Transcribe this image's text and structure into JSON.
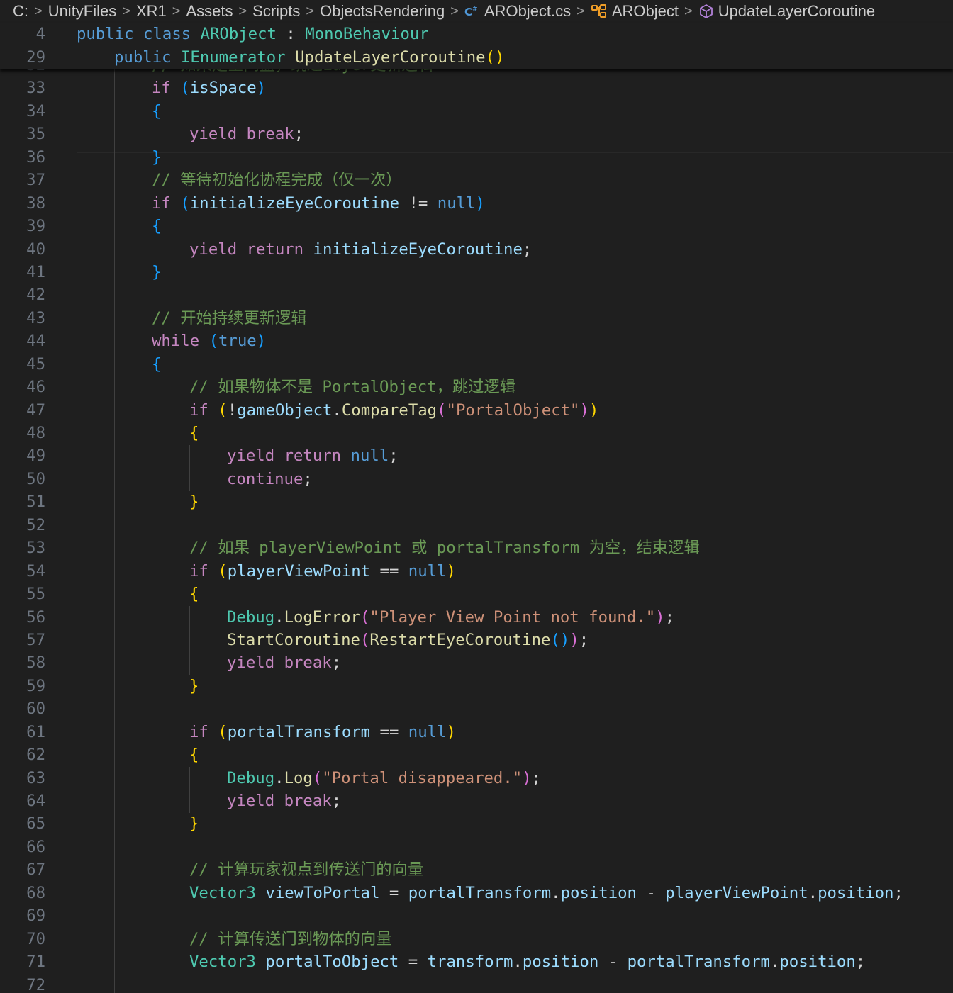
{
  "breadcrumb": {
    "items": [
      {
        "label": "C:",
        "icon": null
      },
      {
        "label": "UnityFiles",
        "icon": null
      },
      {
        "label": "XR1",
        "icon": null
      },
      {
        "label": "Assets",
        "icon": null
      },
      {
        "label": "Scripts",
        "icon": null
      },
      {
        "label": "ObjectsRendering",
        "icon": null
      },
      {
        "label": "ARObject.cs",
        "icon": "csharp-file-icon"
      },
      {
        "label": "ARObject",
        "icon": "class-icon"
      },
      {
        "label": "UpdateLayerCoroutine",
        "icon": "method-icon"
      }
    ],
    "separator": ">"
  },
  "sticky": [
    {
      "num": "4",
      "tokens": [
        [
          "public",
          "kw"
        ],
        [
          " "
        ],
        [
          "class",
          "kw"
        ],
        [
          " "
        ],
        [
          "ARObject",
          "typ"
        ],
        [
          " : "
        ],
        [
          "MonoBehaviour",
          "typ"
        ]
      ]
    },
    {
      "num": "29",
      "indent": 1,
      "tokens": [
        [
          "public",
          "kw"
        ],
        [
          " "
        ],
        [
          "IEnumerator",
          "typ"
        ],
        [
          " "
        ],
        [
          "UpdateLayerCoroutine",
          "fn"
        ],
        [
          "(",
          "p1"
        ],
        [
          ")",
          "p1"
        ]
      ]
    }
  ],
  "code": [
    {
      "num": "32",
      "indent": 2,
      "tokens": [
        [
          "// 如果是空间盒，跳过Layer更新逻辑",
          "cmt"
        ]
      ]
    },
    {
      "num": "33",
      "indent": 2,
      "tokens": [
        [
          "if",
          "ctl"
        ],
        [
          " "
        ],
        [
          "(",
          "p3"
        ],
        [
          "isSpace",
          "var"
        ],
        [
          ")",
          "p3"
        ]
      ]
    },
    {
      "num": "34",
      "indent": 2,
      "tokens": [
        [
          "{",
          "p3"
        ]
      ]
    },
    {
      "num": "35",
      "indent": 3,
      "tokens": [
        [
          "yield",
          "ctl"
        ],
        [
          " "
        ],
        [
          "break",
          "ctl"
        ],
        [
          ";"
        ]
      ]
    },
    {
      "num": "36",
      "indent": 2,
      "tokens": [
        [
          "}",
          "p3"
        ]
      ]
    },
    {
      "num": "37",
      "indent": 2,
      "tokens": [
        [
          "// 等待初始化协程完成（仅一次）",
          "cmt"
        ]
      ]
    },
    {
      "num": "38",
      "indent": 2,
      "tokens": [
        [
          "if",
          "ctl"
        ],
        [
          " "
        ],
        [
          "(",
          "p3"
        ],
        [
          "initializeEyeCoroutine",
          "var"
        ],
        [
          " != "
        ],
        [
          "null",
          "kw"
        ],
        [
          ")",
          "p3"
        ]
      ]
    },
    {
      "num": "39",
      "indent": 2,
      "tokens": [
        [
          "{",
          "p3"
        ]
      ]
    },
    {
      "num": "40",
      "indent": 3,
      "tokens": [
        [
          "yield",
          "ctl"
        ],
        [
          " "
        ],
        [
          "return",
          "ctl"
        ],
        [
          " "
        ],
        [
          "initializeEyeCoroutine",
          "var"
        ],
        [
          ";"
        ]
      ]
    },
    {
      "num": "41",
      "indent": 2,
      "tokens": [
        [
          "}",
          "p3"
        ]
      ]
    },
    {
      "num": "42",
      "indent": 0,
      "tokens": []
    },
    {
      "num": "43",
      "indent": 2,
      "tokens": [
        [
          "// 开始持续更新逻辑",
          "cmt"
        ]
      ]
    },
    {
      "num": "44",
      "indent": 2,
      "tokens": [
        [
          "while",
          "ctl"
        ],
        [
          " "
        ],
        [
          "(",
          "p3"
        ],
        [
          "true",
          "kw"
        ],
        [
          ")",
          "p3"
        ]
      ]
    },
    {
      "num": "45",
      "indent": 2,
      "tokens": [
        [
          "{",
          "p3"
        ]
      ]
    },
    {
      "num": "46",
      "indent": 3,
      "tokens": [
        [
          "// 如果物体不是 PortalObject，跳过逻辑",
          "cmt"
        ]
      ]
    },
    {
      "num": "47",
      "indent": 3,
      "tokens": [
        [
          "if",
          "ctl"
        ],
        [
          " "
        ],
        [
          "(",
          "p1"
        ],
        [
          "!"
        ],
        [
          "gameObject",
          "var"
        ],
        [
          "."
        ],
        [
          "CompareTag",
          "fn"
        ],
        [
          "(",
          "p2"
        ],
        [
          "\"PortalObject\"",
          "str"
        ],
        [
          ")",
          "p2"
        ],
        [
          ")",
          "p1"
        ]
      ]
    },
    {
      "num": "48",
      "indent": 3,
      "tokens": [
        [
          "{",
          "p1"
        ]
      ]
    },
    {
      "num": "49",
      "indent": 4,
      "tokens": [
        [
          "yield",
          "ctl"
        ],
        [
          " "
        ],
        [
          "return",
          "ctl"
        ],
        [
          " "
        ],
        [
          "null",
          "kw"
        ],
        [
          ";"
        ]
      ]
    },
    {
      "num": "50",
      "indent": 4,
      "tokens": [
        [
          "continue",
          "ctl"
        ],
        [
          ";"
        ]
      ]
    },
    {
      "num": "51",
      "indent": 3,
      "tokens": [
        [
          "}",
          "p1"
        ]
      ]
    },
    {
      "num": "52",
      "indent": 0,
      "tokens": []
    },
    {
      "num": "53",
      "indent": 3,
      "tokens": [
        [
          "// 如果 playerViewPoint 或 portalTransform 为空，结束逻辑",
          "cmt"
        ]
      ]
    },
    {
      "num": "54",
      "indent": 3,
      "tokens": [
        [
          "if",
          "ctl"
        ],
        [
          " "
        ],
        [
          "(",
          "p1"
        ],
        [
          "playerViewPoint",
          "var"
        ],
        [
          " == "
        ],
        [
          "null",
          "kw"
        ],
        [
          ")",
          "p1"
        ]
      ]
    },
    {
      "num": "55",
      "indent": 3,
      "tokens": [
        [
          "{",
          "p1"
        ]
      ]
    },
    {
      "num": "56",
      "indent": 4,
      "tokens": [
        [
          "Debug",
          "typ"
        ],
        [
          "."
        ],
        [
          "LogError",
          "fn"
        ],
        [
          "(",
          "p2"
        ],
        [
          "\"Player View Point not found.\"",
          "str"
        ],
        [
          ")",
          "p2"
        ],
        [
          ";"
        ]
      ]
    },
    {
      "num": "57",
      "indent": 4,
      "tokens": [
        [
          "StartCoroutine",
          "fn"
        ],
        [
          "(",
          "p2"
        ],
        [
          "RestartEyeCoroutine",
          "fn"
        ],
        [
          "(",
          "p3"
        ],
        [
          ")",
          "p3"
        ],
        [
          ")",
          "p2"
        ],
        [
          ";"
        ]
      ]
    },
    {
      "num": "58",
      "indent": 4,
      "tokens": [
        [
          "yield",
          "ctl"
        ],
        [
          " "
        ],
        [
          "break",
          "ctl"
        ],
        [
          ";"
        ]
      ]
    },
    {
      "num": "59",
      "indent": 3,
      "tokens": [
        [
          "}",
          "p1"
        ]
      ]
    },
    {
      "num": "60",
      "indent": 0,
      "tokens": []
    },
    {
      "num": "61",
      "indent": 3,
      "tokens": [
        [
          "if",
          "ctl"
        ],
        [
          " "
        ],
        [
          "(",
          "p1"
        ],
        [
          "portalTransform",
          "var"
        ],
        [
          " == "
        ],
        [
          "null",
          "kw"
        ],
        [
          ")",
          "p1"
        ]
      ]
    },
    {
      "num": "62",
      "indent": 3,
      "tokens": [
        [
          "{",
          "p1"
        ]
      ]
    },
    {
      "num": "63",
      "indent": 4,
      "tokens": [
        [
          "Debug",
          "typ"
        ],
        [
          "."
        ],
        [
          "Log",
          "fn"
        ],
        [
          "(",
          "p2"
        ],
        [
          "\"Portal disappeared.\"",
          "str"
        ],
        [
          ")",
          "p2"
        ],
        [
          ";"
        ]
      ]
    },
    {
      "num": "64",
      "indent": 4,
      "tokens": [
        [
          "yield",
          "ctl"
        ],
        [
          " "
        ],
        [
          "break",
          "ctl"
        ],
        [
          ";"
        ]
      ]
    },
    {
      "num": "65",
      "indent": 3,
      "tokens": [
        [
          "}",
          "p1"
        ]
      ]
    },
    {
      "num": "66",
      "indent": 0,
      "tokens": []
    },
    {
      "num": "67",
      "indent": 3,
      "tokens": [
        [
          "// 计算玩家视点到传送门的向量",
          "cmt"
        ]
      ]
    },
    {
      "num": "68",
      "indent": 3,
      "tokens": [
        [
          "Vector3",
          "typ"
        ],
        [
          " "
        ],
        [
          "viewToPortal",
          "var"
        ],
        [
          " = "
        ],
        [
          "portalTransform",
          "var"
        ],
        [
          "."
        ],
        [
          "position",
          "var"
        ],
        [
          " - "
        ],
        [
          "playerViewPoint",
          "var"
        ],
        [
          "."
        ],
        [
          "position",
          "var"
        ],
        [
          ";"
        ]
      ]
    },
    {
      "num": "69",
      "indent": 0,
      "tokens": []
    },
    {
      "num": "70",
      "indent": 3,
      "tokens": [
        [
          "// 计算传送门到物体的向量",
          "cmt"
        ]
      ]
    },
    {
      "num": "71",
      "indent": 3,
      "tokens": [
        [
          "Vector3",
          "typ"
        ],
        [
          " "
        ],
        [
          "portalToObject",
          "var"
        ],
        [
          " = "
        ],
        [
          "transform",
          "var"
        ],
        [
          "."
        ],
        [
          "position",
          "var"
        ],
        [
          " - "
        ],
        [
          "portalTransform",
          "var"
        ],
        [
          "."
        ],
        [
          "position",
          "var"
        ],
        [
          ";"
        ]
      ]
    },
    {
      "num": "72",
      "indent": 0,
      "tokens": []
    }
  ]
}
